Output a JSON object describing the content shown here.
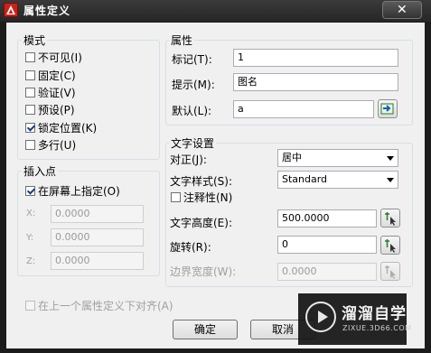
{
  "window": {
    "title": "属性定义",
    "close_glyph": "✕",
    "app_icon": "autocad-logo-icon",
    "accent_color": "#c8231a"
  },
  "mode": {
    "title": "模式",
    "items": [
      {
        "label": "不可见(I)",
        "checked": false
      },
      {
        "label": "固定(C)",
        "checked": false
      },
      {
        "label": "验证(V)",
        "checked": false
      },
      {
        "label": "预设(P)",
        "checked": false
      },
      {
        "label": "锁定位置(K)",
        "checked": true
      },
      {
        "label": "多行(U)",
        "checked": false
      }
    ]
  },
  "insertion": {
    "title": "插入点",
    "on_screen_label": "在屏幕上指定(O)",
    "on_screen_checked": true,
    "fields": [
      {
        "label": "X:",
        "value": "0.0000"
      },
      {
        "label": "Y:",
        "value": "0.0000"
      },
      {
        "label": "Z:",
        "value": "0.0000"
      }
    ]
  },
  "attribute": {
    "title": "属性",
    "tag_label": "标记(T):",
    "tag_value": "1",
    "prompt_label": "提示(M):",
    "prompt_value": "图名",
    "default_label": "默认(L):",
    "default_value": "a"
  },
  "text_settings": {
    "title": "文字设置",
    "justify_label": "对正(J):",
    "justify_value": "居中",
    "style_label": "文字样式(S):",
    "style_value": "Standard",
    "annotative_label": "注释性(N)",
    "annotative_checked": false,
    "height_label": "文字高度(E):",
    "height_value": "500.0000",
    "rotation_label": "旋转(R):",
    "rotation_value": "0",
    "boundary_label": "边界宽度(W):",
    "boundary_value": "0.0000"
  },
  "align_below": {
    "label": "在上一个属性定义下对齐(A)",
    "checked": false
  },
  "buttons": {
    "ok": "确定",
    "cancel": "取消"
  },
  "watermark": {
    "brand": "溜溜自学",
    "url": "ZIXUE.3D66.COM"
  }
}
